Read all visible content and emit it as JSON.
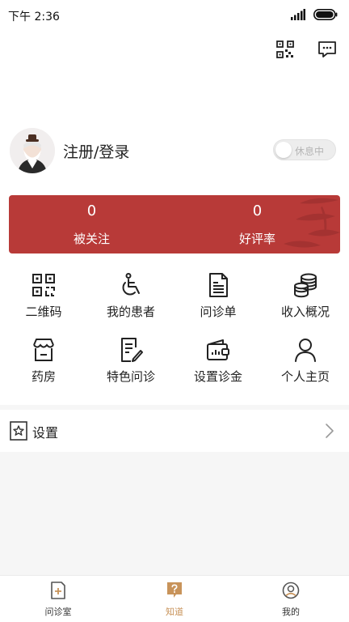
{
  "status_bar": {
    "time": "下午 2:36"
  },
  "profile": {
    "login_text": "注册/登录",
    "rest_toggle_label": "休息中"
  },
  "stats": [
    {
      "value": "0",
      "label": "被关注"
    },
    {
      "value": "0",
      "label": "好评率"
    }
  ],
  "grid": [
    {
      "label": "二维码",
      "icon": "qr-code-icon"
    },
    {
      "label": "我的患者",
      "icon": "wheelchair-icon"
    },
    {
      "label": "问诊单",
      "icon": "document-icon"
    },
    {
      "label": "收入概况",
      "icon": "coins-icon"
    },
    {
      "label": "药房",
      "icon": "pharmacy-icon"
    },
    {
      "label": "特色问诊",
      "icon": "edit-doc-icon"
    },
    {
      "label": "设置诊金",
      "icon": "wallet-icon"
    },
    {
      "label": "个人主页",
      "icon": "person-icon"
    }
  ],
  "settings": {
    "label": "设置"
  },
  "tabs": [
    {
      "label": "问诊室",
      "icon": "consult-room-icon"
    },
    {
      "label": "知道",
      "icon": "question-icon"
    },
    {
      "label": "我的",
      "icon": "profile-icon"
    }
  ],
  "colors": {
    "brand_red": "#b83a38",
    "active_tab": "#c8935a"
  }
}
